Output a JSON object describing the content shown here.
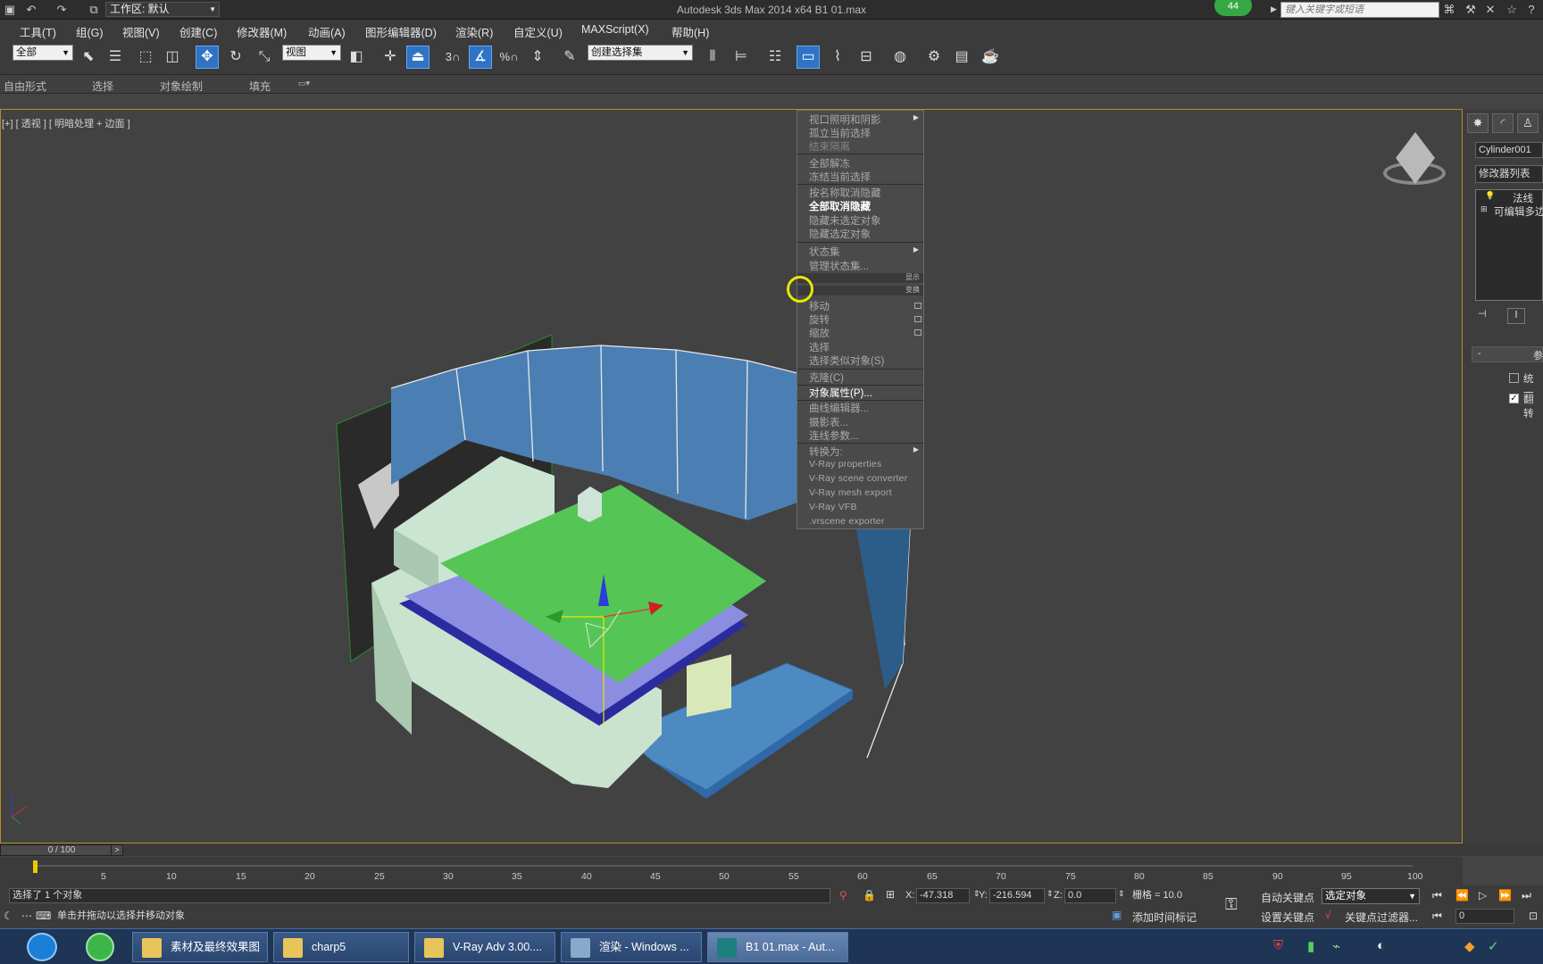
{
  "titlebar": {
    "title": "Autodesk 3ds Max  2014 x64      B1 01.max",
    "workspace": "工作区: 默认",
    "search_placeholder": "键入关键字或短语",
    "badge": "44"
  },
  "menu": [
    "工具(T)",
    "组(G)",
    "视图(V)",
    "创建(C)",
    "修改器(M)",
    "动画(A)",
    "图形编辑器(D)",
    "渲染(R)",
    "自定义(U)",
    "MAXScript(X)",
    "帮助(H)"
  ],
  "toolbar": {
    "filter": "全部",
    "refcoord": "视图",
    "selset": "创建选择集",
    "snap3": "3",
    "pct": "%"
  },
  "ribbon": [
    "自由形式",
    "选择",
    "对象绘制",
    "填充"
  ],
  "viewport": {
    "label": "[+] [ 透视 ] [ 明暗处理 + 边面 ]"
  },
  "context_menu": {
    "group1": [
      "视口照明和阴影",
      "孤立当前选择",
      "结束隔离",
      "全部解冻",
      "冻结当前选择",
      "按名称取消隐藏",
      "全部取消隐藏",
      "隐藏未选定对象",
      "隐藏选定对象",
      "状态集",
      "管理状态集..."
    ],
    "bar_display": "显示",
    "bar_transform": "变换",
    "group2": [
      "移动",
      "旋转",
      "缩放",
      "选择",
      "选择类似对象(S)",
      "克隆(C)",
      "对象属性(P)...",
      "曲线编辑器...",
      "摄影表...",
      "连线参数...",
      "转换为:"
    ],
    "vray": [
      "V-Ray properties",
      "V-Ray scene converter",
      "V-Ray mesh export",
      "V-Ray VFB",
      ".vrscene exporter"
    ]
  },
  "cmdpanel": {
    "object_name": "Cylinder001",
    "modifier_list": "修改器列表",
    "stack": [
      "法线",
      "可编辑多边"
    ],
    "rollout": "参",
    "chk1": "统一",
    "chk2": "翻转"
  },
  "timeline": {
    "frame": "0 / 100",
    "ticks": [
      "5",
      "10",
      "15",
      "20",
      "25",
      "30",
      "35",
      "40",
      "45",
      "50",
      "55",
      "60",
      "65",
      "70",
      "75",
      "80",
      "85",
      "90",
      "95",
      "100"
    ]
  },
  "status": {
    "selected": "选择了 1 个对象",
    "prompt": "单击并拖动以选择并移动对象",
    "x_label": "X:",
    "x": "-47.318",
    "y_label": "Y:",
    "y": "-216.594",
    "z_label": "Z:",
    "z": "0.0",
    "grid": "栅格 = 10.0",
    "autokey": "自动关键点",
    "setkey": "设置关键点",
    "keyfilter_sel": "选定对象",
    "keyfilters": "关键点过滤器...",
    "add_time_tag": "添加时间标记",
    "frame_field": "0"
  },
  "taskbar": [
    "素材及最终效果图",
    "charp5",
    "V-Ray Adv 3.00....",
    "渲染 - Windows ...",
    "B1 01.max - Aut..."
  ]
}
